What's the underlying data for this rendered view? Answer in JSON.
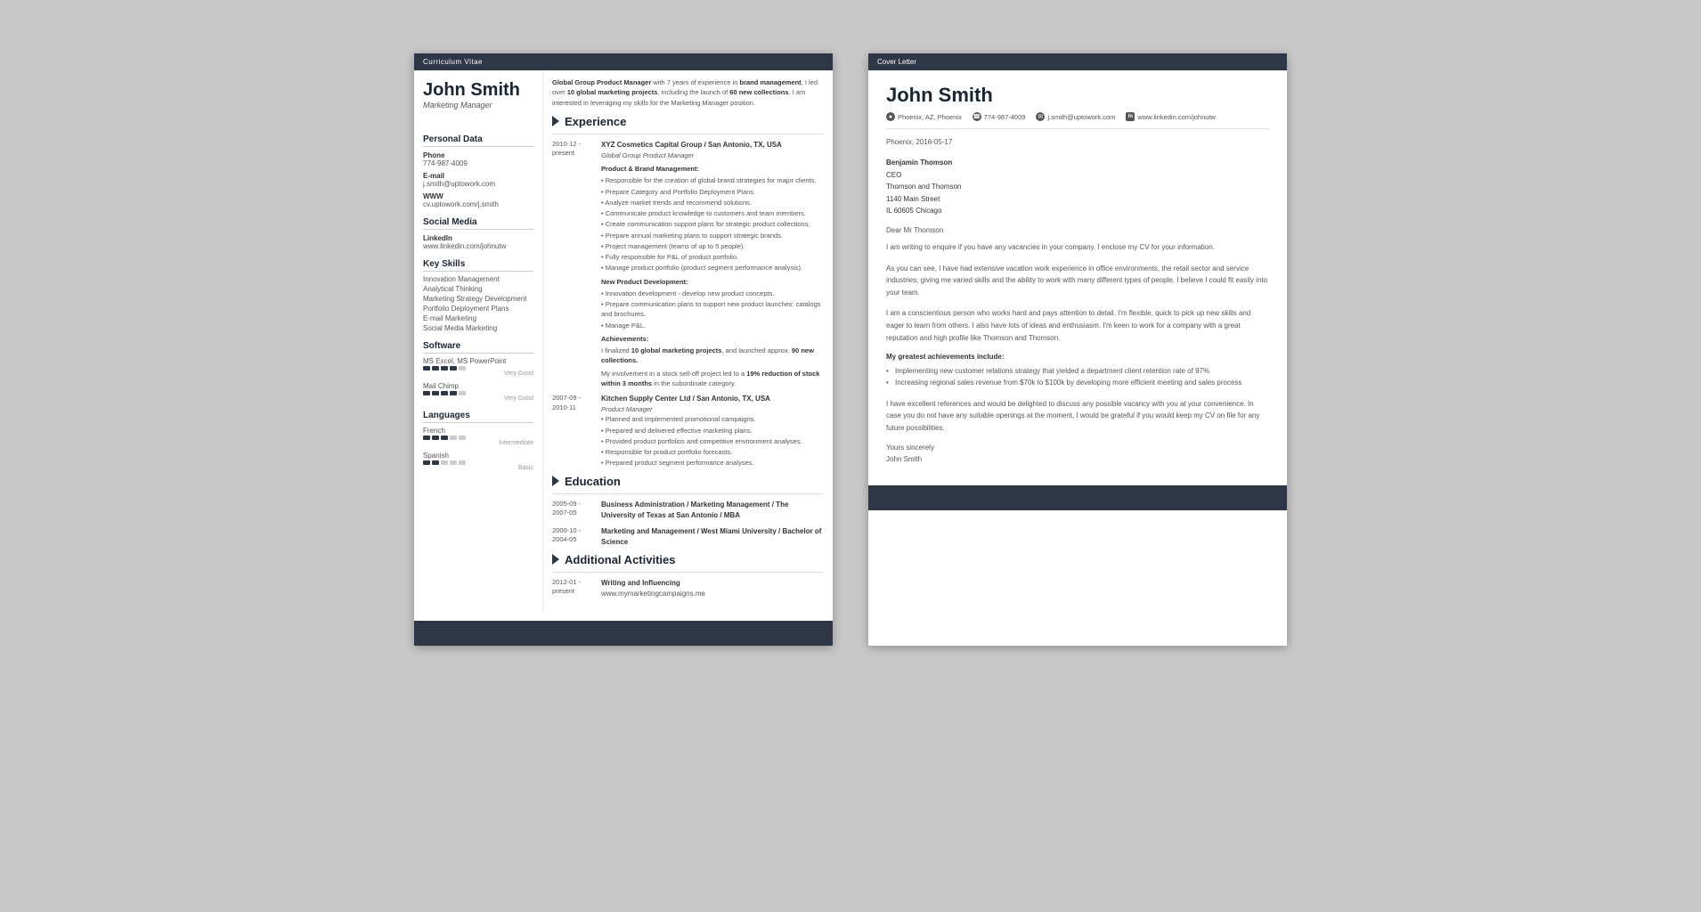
{
  "cv": {
    "header": "Curriculum Vitae",
    "name": "John Smith",
    "title": "Marketing Manager",
    "intro": {
      "text": "with 7 years of experience in brand management, I led over 10 global marketing projects, including the launch of 60 new collections. I am interested in leveraging my skills for the Marketing Manager position.",
      "bold_start": "Global Group Product Manager"
    },
    "sidebar": {
      "personal_data_title": "Personal Data",
      "phone_label": "Phone",
      "phone": "774-987-4009",
      "email_label": "E-mail",
      "email": "j.smith@uptowork.com",
      "www_label": "WWW",
      "www": "cv.uptowork.com/j.smith",
      "social_title": "Social Media",
      "linkedin_label": "LinkedIn",
      "linkedin": "www.linkedin.com/johnutw",
      "skills_title": "Key Skills",
      "skills": [
        "Innovation Management",
        "Analytical Thinking",
        "Marketing Strategy Development",
        "Portfolio Deployment Plans",
        "E-mail Marketing",
        "Social Media Marketing"
      ],
      "software_title": "Software",
      "software": [
        {
          "name": "MS Excel, MS PowerPoint",
          "filled": 4,
          "empty": 1,
          "label": "Very Good"
        },
        {
          "name": "Mail Chimp",
          "filled": 4,
          "empty": 1,
          "label": "Very Good"
        }
      ],
      "languages_title": "Languages",
      "languages": [
        {
          "name": "French",
          "filled": 3,
          "empty": 2,
          "label": "Intermediate"
        },
        {
          "name": "Spanish",
          "filled": 2,
          "empty": 3,
          "label": "Basic"
        }
      ]
    },
    "experience_title": "Experience",
    "experience": [
      {
        "date": "2010-12 - present",
        "company": "XYZ Cosmetics Capital Group / San Antonio, TX, USA",
        "role": "Global Group Product Manager",
        "subsections": [
          {
            "title": "Product & Brand Management:",
            "bullets": [
              "Responsible for the creation of global brand strategies for major clients.",
              "Prepare Category and Portfolio Deployment Plans.",
              "Analyze market trends and recommend solutions.",
              "Communicate product knowledge to customers and team members.",
              "Create communication support plans for strategic product collections.",
              "Prepare annual marketing plans to support strategic brands.",
              "Project management (teams of up to 5 people).",
              "Fully responsible for P&L of product portfolio.",
              "Manage product portfolio (product segment performance analysis)."
            ]
          },
          {
            "title": "New Product Development:",
            "bullets": [
              "Innovation development - develop new product concepts.",
              "Prepare communication plans to support new product launches: catalogs and brochures.",
              "Manage P&L."
            ]
          }
        ],
        "achievements_title": "Achievements:",
        "achievements": [
          "I finalized 10 global marketing projects, and launched approx. 90 new collections.",
          "My involvement in a stock sell-off project led to a 19% reduction of stock within 3 months in the subordinate category."
        ]
      },
      {
        "date": "2007-09 - 2010-11",
        "company": "Kitchen Supply Center Ltd / San Antonio, TX, USA",
        "role": "Product Manager",
        "bullets": [
          "Planned and implemented promotional campaigns.",
          "Prepared and delivered effective marketing plans.",
          "Provided product portfolios and competitive environment analyses.",
          "Responsible for product portfolio forecasts.",
          "Prepared product segment performance analyses."
        ]
      }
    ],
    "education_title": "Education",
    "education": [
      {
        "date": "2005-09 - 2007-05",
        "degree": "Business Administration / Marketing Management / The University of Texas at San Antonio / MBA"
      },
      {
        "date": "2000-10 - 2004-05",
        "degree": "Marketing and Management / West Miami University / Bachelor of Science"
      }
    ],
    "activities_title": "Additional Activities",
    "activities": [
      {
        "date": "2012-01 - present",
        "title": "Writing and Influencing",
        "detail": "www.mymarketingcampaigns.me"
      }
    ]
  },
  "cover": {
    "header": "Cover Letter",
    "name": "John Smith",
    "contact": {
      "location": "Phoenix, AZ, Phoenix",
      "phone": "774-987-4009",
      "email": "j.smith@uptowork.com",
      "linkedin": "www.linkedin.com/johnutw"
    },
    "date": "Phoenix, 2016-05-17",
    "recipient": {
      "name": "Benjamin Thomson",
      "title": "CEO",
      "company": "Thomson and Thomson",
      "address": "1140 Main Street",
      "city": "IL 60605 Chicago"
    },
    "salutation": "Dear Mr Thomson",
    "paragraphs": [
      "I am writing to enquire if you have any vacancies in your company. I enclose my CV for your information.",
      "As you can see, I have had extensive vacation work experience in office environments, the retail sector and service industries, giving me varied skills and the ability to work with many different types of people. I believe I could fit easily into your team.",
      "I am a conscientious person who works hard and pays attention to detail. I'm flexible, quick to pick up new skills and eager to learn from others. I also have lots of ideas and enthusiasm. I'm keen to work for a company with a great reputation and high profile like Thomson and Thomson."
    ],
    "achievements_title": "My greatest achievements include:",
    "achievements": [
      "Implementing new customer relations strategy that yielded a department client retention rate of 97%",
      "Increasing regional sales revenue from $70k to $100k by developing more efficient meeting and sales process"
    ],
    "final_paragraph": "I have excellent references and would be delighted to discuss any possible vacancy with you at your convenience. In case you do not have any suitable openings at the moment, I would be grateful if you would keep my CV on file for any future possibilities.",
    "closing": "Yours sincerely",
    "signature": "John Smith"
  }
}
